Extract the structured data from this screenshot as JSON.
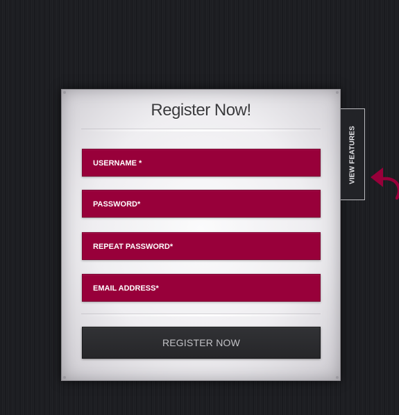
{
  "form": {
    "title": "Register Now!",
    "fields": [
      {
        "label": "USERNAME *"
      },
      {
        "label": "PASSWORD*"
      },
      {
        "label": "REPEAT PASSWORD*"
      },
      {
        "label": "EMAIL ADDRESS*"
      }
    ],
    "submit_label": "REGISTER NOW"
  },
  "side_tab": {
    "label": "VIEW FEATURES"
  },
  "icons": {
    "side_arrow": "curved-back-arrow-icon"
  },
  "colors": {
    "field_bg": "#98003a",
    "button_bg": "#2b2c2f",
    "page_bg": "#1d1e22",
    "arrow": "#98003a"
  }
}
